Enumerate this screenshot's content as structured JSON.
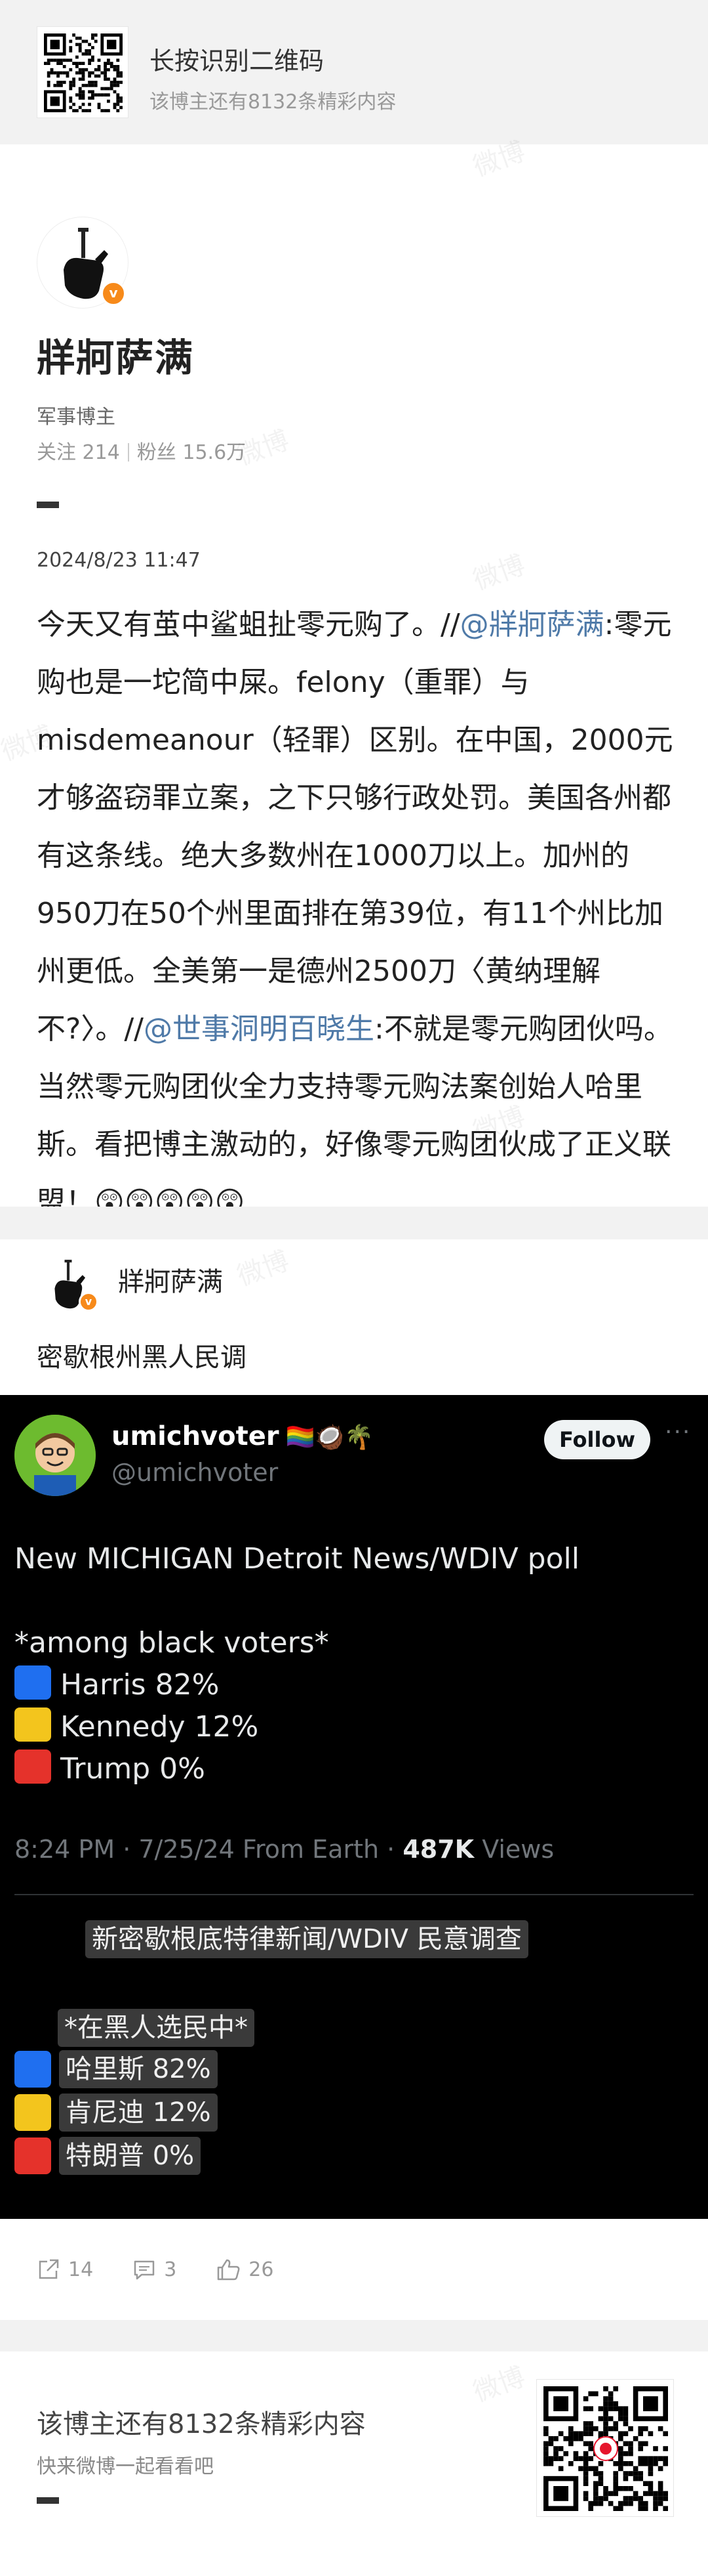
{
  "banner": {
    "title": "长按识别二维码",
    "subtitle": "该博主还有8132条精彩内容"
  },
  "author": {
    "name": "牂牁萨满",
    "role": "军事博主",
    "following_label": "关注",
    "following_count": "214",
    "followers_label": "粉丝",
    "followers_count": "15.6万",
    "verified_badge": "v"
  },
  "post": {
    "date": "2024/8/23 11:47",
    "text_1": "今天又有茧中鲨蛆扯零元购了。//",
    "mention_1": "@牂牁萨满",
    "text_2": ":零元购也是一坨简中屎。felony（重罪）与misdemeanour（轻罪）区别。在中国，2000元才够盗窃罪立案，之下只够行政处罚。美国各州都有这条线。绝大多数州在1000刀以上。加州的950刀在50个州里面排在第39位，有11个州比加州更低。全美第一是德州2500刀〈黄纳理解不?〉。//",
    "mention_2": "@世事洞明百晓生",
    "text_3": ":不就是零元购团伙吗。当然零元购团伙全力支持零元购法案创始人哈里斯。看把博主激动的，好像零元购团伙成了正义联盟！😲😲😲😲😲"
  },
  "repost": {
    "author": "牂牁萨满",
    "text": "密歇根州黑人民调"
  },
  "tweet": {
    "name": "umichvoter",
    "name_emoji": "🏳️‍🌈🥥🌴",
    "handle": "@umichvoter",
    "follow_label": "Follow",
    "more": "···",
    "line_1": "New MICHIGAN Detroit News/WDIV poll",
    "line_2": "*among black voters*",
    "harris": "Harris 82%",
    "kennedy": "Kennedy 12%",
    "trump": "Trump 0%",
    "time": "8:24 PM · 7/25/24 From Earth ·",
    "views_count": "487K",
    "views_label": "Views",
    "tr_title": "新密歇根底特律新闻/WDIV 民意调查",
    "tr_among": "*在黑人选民中*",
    "tr_harris": "哈里斯 82%",
    "tr_kennedy": "肯尼迪 12%",
    "tr_trump": "特朗普 0%",
    "colors": {
      "harris": "#1f6ff0",
      "kennedy": "#f3c51d",
      "trump": "#e5322b"
    }
  },
  "actions": {
    "reposts": "14",
    "comments": "3",
    "likes": "26"
  },
  "promo": {
    "title": "该博主还有8132条精彩内容",
    "subtitle": "快来微博一起看看吧"
  },
  "watermark": "微博"
}
